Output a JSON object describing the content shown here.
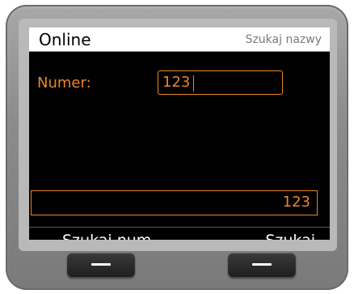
{
  "header": {
    "title": "Online",
    "context": "Szukaj nazwy"
  },
  "search_form": {
    "label": "Numer:",
    "value": "123"
  },
  "number_display": {
    "value": "123"
  },
  "softkeys": {
    "left_label": "Szukaj num.",
    "right_label": "Szukaj"
  },
  "colors": {
    "accent": "#e8852b",
    "screen_background": "#000000",
    "header_background": "#ffffff"
  },
  "icons": {
    "hardware_key_left": "dash-icon",
    "hardware_key_right": "dash-icon"
  }
}
